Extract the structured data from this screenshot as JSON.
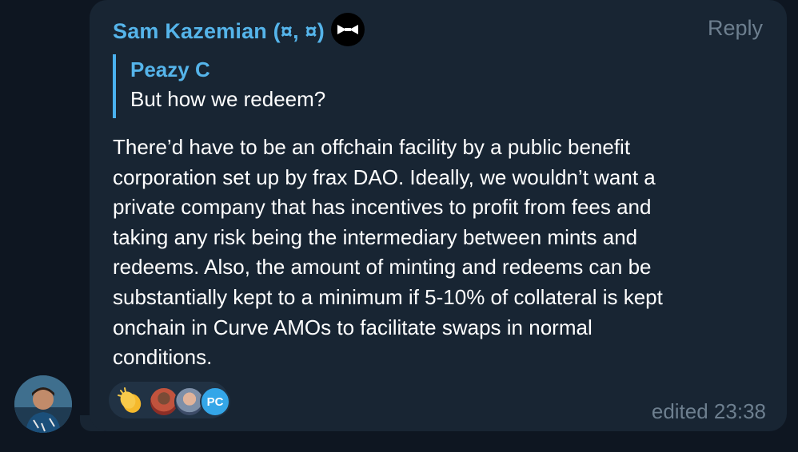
{
  "message": {
    "sender_name": "Sam Kazemian (¤, ¤)",
    "reply_label": "Reply",
    "quote": {
      "author": "Peazy C",
      "text": "But how we redeem?"
    },
    "body": [
      "There’d have to be an offchain facility by a public benefit",
      "corporation set up by frax DAO. Ideally, we wouldn’t want a",
      "private company that has incentives to profit from fees and",
      "taking any risk being the intermediary between mints and",
      "redeems. Also, the amount of minting and redeems can be",
      "substantially kept to a minimum if 5-10% of collateral is kept",
      "onchain in Curve AMOs to facilitate swaps in normal",
      "conditions."
    ],
    "edited_label": "edited 23:38",
    "reactions": {
      "emoji": "clapping-hands",
      "reactor_initials": "PC"
    }
  },
  "colors": {
    "background": "#0e1621",
    "bubble": "#182533",
    "accent": "#55b4ea",
    "muted": "#6d7f8f"
  }
}
